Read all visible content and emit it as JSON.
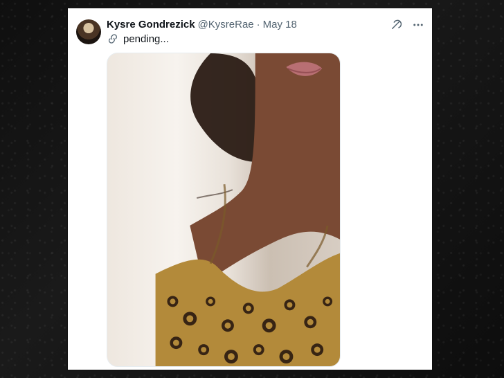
{
  "tweet": {
    "author": {
      "display_name": "Kysre Gondrezick",
      "handle": "@KysreRae",
      "separator": "·",
      "date": "May 18"
    },
    "text": "pending...",
    "icons": {
      "link": "link-icon",
      "grok": "grok-icon",
      "more": "more-icon"
    },
    "colors": {
      "name": "#0f1419",
      "meta": "#536471",
      "card_bg": "#ffffff"
    }
  }
}
